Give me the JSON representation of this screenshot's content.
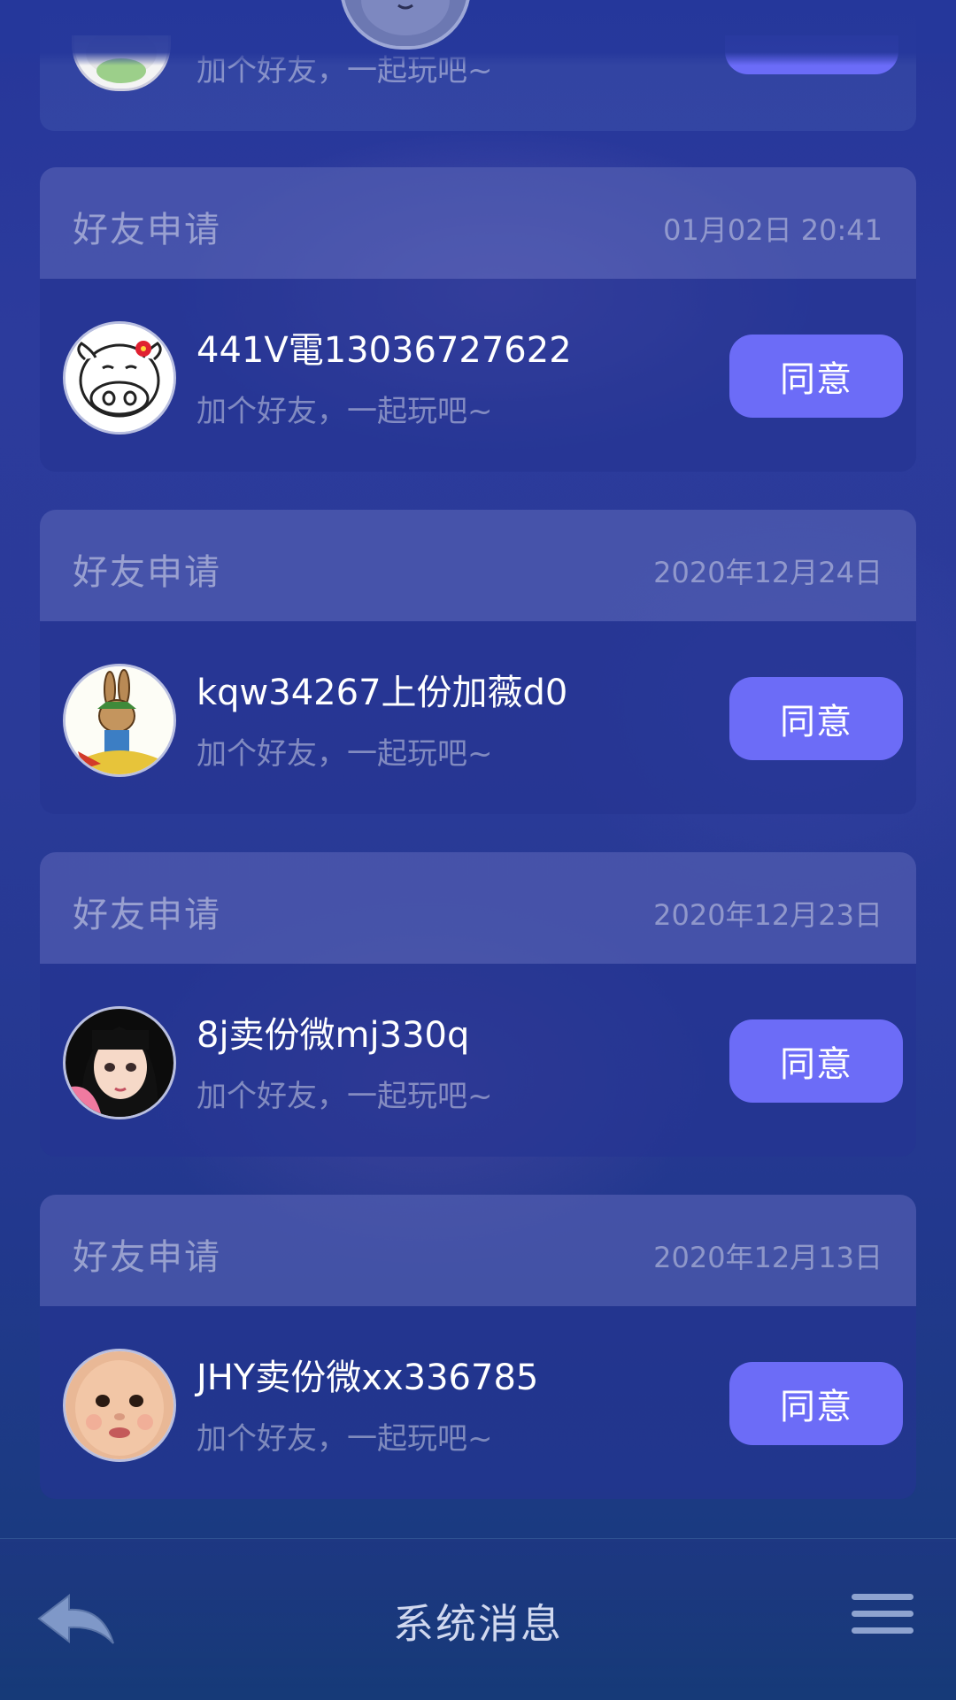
{
  "partial_item": {
    "message": "加个好友，一起玩吧~"
  },
  "requests": [
    {
      "type": "好友申请",
      "time": "01月02日 20:41",
      "name": "441V電13036727622",
      "message": "加个好友，一起玩吧~",
      "button": "同意",
      "avatar": "cow-avatar"
    },
    {
      "type": "好友申请",
      "time": "2020年12月24日",
      "name": "kqw34267上份加薇d0",
      "message": "加个好友，一起玩吧~",
      "button": "同意",
      "avatar": "rabbit-avatar"
    },
    {
      "type": "好友申请",
      "time": "2020年12月23日",
      "name": "8j卖份微mj330q",
      "message": "加个好友，一起玩吧~",
      "button": "同意",
      "avatar": "girl-avatar"
    },
    {
      "type": "好友申请",
      "time": "2020年12月13日",
      "name": "JHY卖份微xx336785",
      "message": "加个好友，一起玩吧~",
      "button": "同意",
      "avatar": "baby-avatar"
    }
  ],
  "bottom_bar": {
    "title": "系统消息",
    "back_icon": "back-arrow-icon",
    "menu_icon": "menu-icon"
  },
  "colors": {
    "accent_button": "#6c6cf7",
    "background": "#2a3a98"
  }
}
